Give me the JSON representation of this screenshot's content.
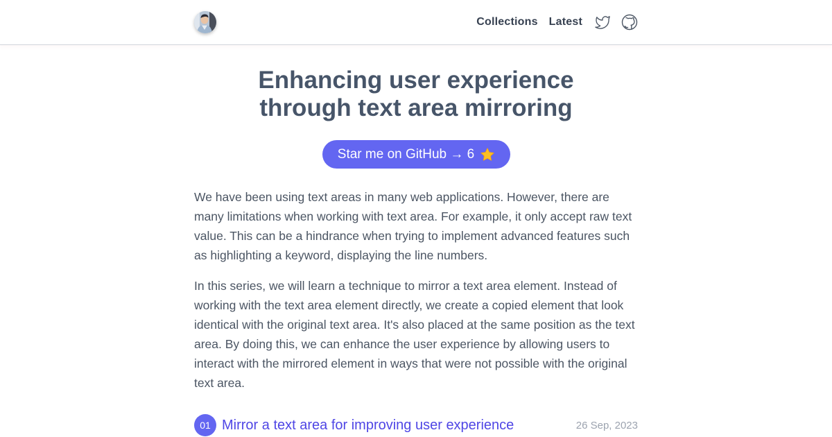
{
  "header": {
    "avatar_alt": "avatar",
    "nav": [
      {
        "label": "Collections"
      },
      {
        "label": "Latest"
      }
    ],
    "icons": [
      "twitter-icon",
      "github-icon"
    ]
  },
  "main": {
    "title_line1": "Enhancing user experience",
    "title_line2": "through text area mirroring",
    "star_button": "Star me on GitHub → 6",
    "paragraphs": [
      "We have been using text areas in many web applications. However, there are many limitations when working with text area. For example, it only accept raw text value. This can be a hindrance when trying to implement advanced features such as highlighting a keyword, displaying the line numbers.",
      "In this series, we will learn a technique to mirror a text area element. Instead of working with the text area element directly, we create a copied element that look identical with the original text area. It's also placed at the same position as the text area. By doing this, we can enhance the user experience by allowing users to interact with the mirrored element in ways that were not possible with the original text area."
    ],
    "posts": [
      {
        "number": "01",
        "title": "Mirror a text area for improving user experience",
        "date": "26 Sep, 2023"
      }
    ]
  },
  "colors": {
    "accent": "#6366f1",
    "link": "#4f46e5",
    "title": "#475569",
    "text": "#4b5563",
    "muted": "#9ca3af"
  }
}
